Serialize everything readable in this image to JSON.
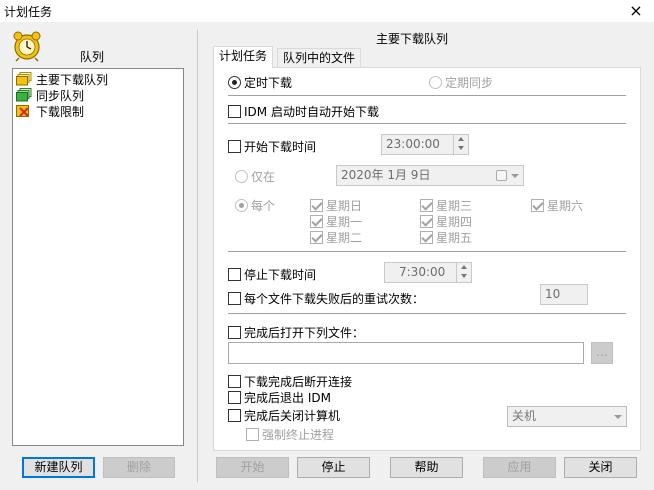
{
  "window": {
    "title": "计划任务",
    "close_glyph": "×"
  },
  "queues": {
    "label": "队列",
    "items": [
      {
        "label": "主要下载队列"
      },
      {
        "label": "同步队列"
      },
      {
        "label": "下载限制"
      }
    ],
    "new_button": "新建队列",
    "delete_button": "删除"
  },
  "panel": {
    "title": "主要下载队列",
    "tabs": [
      {
        "label": "计划任务"
      },
      {
        "label": "队列中的文件"
      }
    ]
  },
  "schedule": {
    "one_time": "定时下载",
    "periodic_sync": "定期同步",
    "start_on_idm_startup": "IDM 启动时自动开始下载",
    "start_download_at": "开始下载时间",
    "start_time": "23:00:00",
    "once_label": "仅在",
    "date_value": "2020年  1月  9日",
    "daily_label": "每个",
    "days": [
      {
        "label": "星期日",
        "checked": true
      },
      {
        "label": "星期三",
        "checked": true
      },
      {
        "label": "星期六",
        "checked": true
      },
      {
        "label": "星期一",
        "checked": true
      },
      {
        "label": "星期四",
        "checked": true
      },
      {
        "label": "星期二",
        "checked": true
      },
      {
        "label": "星期五",
        "checked": true
      }
    ],
    "stop_download_at": "停止下载时间",
    "stop_time": "7:30:00",
    "retry_label": "每个文件下载失败后的重试次数：",
    "retry_count": "10",
    "open_file_label": "完成后打开下列文件：",
    "open_file_path": "",
    "browse_label": "...",
    "hang_up_label": "下载完成后断开连接",
    "exit_idm_label": "完成后退出 IDM",
    "shutdown_label": "完成后关闭计算机",
    "shutdown_mode": "关机",
    "force_terminate_label": "强制终止进程"
  },
  "footer": {
    "start": "开始",
    "stop": "停止",
    "help": "帮助",
    "apply": "应用",
    "close": "关闭"
  },
  "colors": {
    "window_bg": "#f0f0f0",
    "focus_blue": "#0078d7",
    "disabled_text": "#a0a0a0",
    "queue_icon_yellow": "#f4c20d",
    "queue_icon_green": "#3cb043",
    "limit_icon_red": "#d62d20"
  }
}
